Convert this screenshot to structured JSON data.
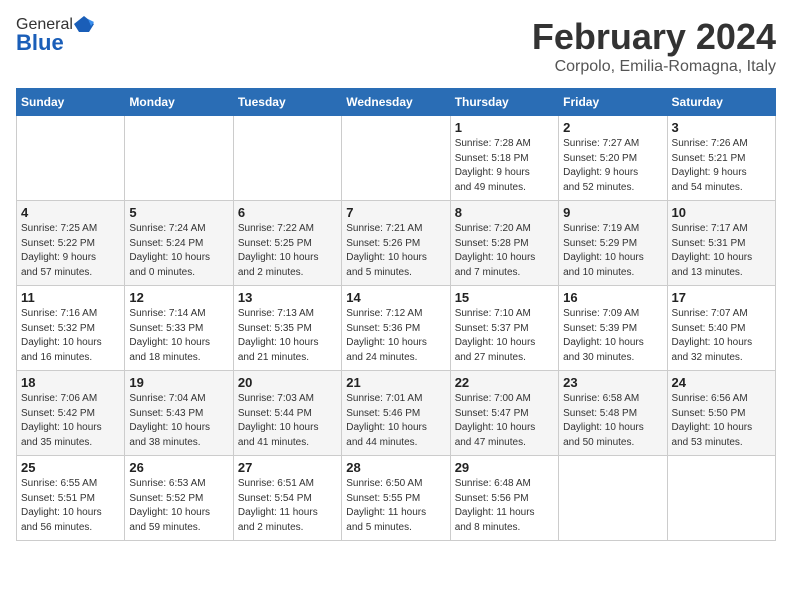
{
  "header": {
    "logo_general": "General",
    "logo_blue": "Blue",
    "month_title": "February 2024",
    "location": "Corpolo, Emilia-Romagna, Italy"
  },
  "days_of_week": [
    "Sunday",
    "Monday",
    "Tuesday",
    "Wednesday",
    "Thursday",
    "Friday",
    "Saturday"
  ],
  "weeks": [
    [
      {
        "day": "",
        "info": ""
      },
      {
        "day": "",
        "info": ""
      },
      {
        "day": "",
        "info": ""
      },
      {
        "day": "",
        "info": ""
      },
      {
        "day": "1",
        "info": "Sunrise: 7:28 AM\nSunset: 5:18 PM\nDaylight: 9 hours\nand 49 minutes."
      },
      {
        "day": "2",
        "info": "Sunrise: 7:27 AM\nSunset: 5:20 PM\nDaylight: 9 hours\nand 52 minutes."
      },
      {
        "day": "3",
        "info": "Sunrise: 7:26 AM\nSunset: 5:21 PM\nDaylight: 9 hours\nand 54 minutes."
      }
    ],
    [
      {
        "day": "4",
        "info": "Sunrise: 7:25 AM\nSunset: 5:22 PM\nDaylight: 9 hours\nand 57 minutes."
      },
      {
        "day": "5",
        "info": "Sunrise: 7:24 AM\nSunset: 5:24 PM\nDaylight: 10 hours\nand 0 minutes."
      },
      {
        "day": "6",
        "info": "Sunrise: 7:22 AM\nSunset: 5:25 PM\nDaylight: 10 hours\nand 2 minutes."
      },
      {
        "day": "7",
        "info": "Sunrise: 7:21 AM\nSunset: 5:26 PM\nDaylight: 10 hours\nand 5 minutes."
      },
      {
        "day": "8",
        "info": "Sunrise: 7:20 AM\nSunset: 5:28 PM\nDaylight: 10 hours\nand 7 minutes."
      },
      {
        "day": "9",
        "info": "Sunrise: 7:19 AM\nSunset: 5:29 PM\nDaylight: 10 hours\nand 10 minutes."
      },
      {
        "day": "10",
        "info": "Sunrise: 7:17 AM\nSunset: 5:31 PM\nDaylight: 10 hours\nand 13 minutes."
      }
    ],
    [
      {
        "day": "11",
        "info": "Sunrise: 7:16 AM\nSunset: 5:32 PM\nDaylight: 10 hours\nand 16 minutes."
      },
      {
        "day": "12",
        "info": "Sunrise: 7:14 AM\nSunset: 5:33 PM\nDaylight: 10 hours\nand 18 minutes."
      },
      {
        "day": "13",
        "info": "Sunrise: 7:13 AM\nSunset: 5:35 PM\nDaylight: 10 hours\nand 21 minutes."
      },
      {
        "day": "14",
        "info": "Sunrise: 7:12 AM\nSunset: 5:36 PM\nDaylight: 10 hours\nand 24 minutes."
      },
      {
        "day": "15",
        "info": "Sunrise: 7:10 AM\nSunset: 5:37 PM\nDaylight: 10 hours\nand 27 minutes."
      },
      {
        "day": "16",
        "info": "Sunrise: 7:09 AM\nSunset: 5:39 PM\nDaylight: 10 hours\nand 30 minutes."
      },
      {
        "day": "17",
        "info": "Sunrise: 7:07 AM\nSunset: 5:40 PM\nDaylight: 10 hours\nand 32 minutes."
      }
    ],
    [
      {
        "day": "18",
        "info": "Sunrise: 7:06 AM\nSunset: 5:42 PM\nDaylight: 10 hours\nand 35 minutes."
      },
      {
        "day": "19",
        "info": "Sunrise: 7:04 AM\nSunset: 5:43 PM\nDaylight: 10 hours\nand 38 minutes."
      },
      {
        "day": "20",
        "info": "Sunrise: 7:03 AM\nSunset: 5:44 PM\nDaylight: 10 hours\nand 41 minutes."
      },
      {
        "day": "21",
        "info": "Sunrise: 7:01 AM\nSunset: 5:46 PM\nDaylight: 10 hours\nand 44 minutes."
      },
      {
        "day": "22",
        "info": "Sunrise: 7:00 AM\nSunset: 5:47 PM\nDaylight: 10 hours\nand 47 minutes."
      },
      {
        "day": "23",
        "info": "Sunrise: 6:58 AM\nSunset: 5:48 PM\nDaylight: 10 hours\nand 50 minutes."
      },
      {
        "day": "24",
        "info": "Sunrise: 6:56 AM\nSunset: 5:50 PM\nDaylight: 10 hours\nand 53 minutes."
      }
    ],
    [
      {
        "day": "25",
        "info": "Sunrise: 6:55 AM\nSunset: 5:51 PM\nDaylight: 10 hours\nand 56 minutes."
      },
      {
        "day": "26",
        "info": "Sunrise: 6:53 AM\nSunset: 5:52 PM\nDaylight: 10 hours\nand 59 minutes."
      },
      {
        "day": "27",
        "info": "Sunrise: 6:51 AM\nSunset: 5:54 PM\nDaylight: 11 hours\nand 2 minutes."
      },
      {
        "day": "28",
        "info": "Sunrise: 6:50 AM\nSunset: 5:55 PM\nDaylight: 11 hours\nand 5 minutes."
      },
      {
        "day": "29",
        "info": "Sunrise: 6:48 AM\nSunset: 5:56 PM\nDaylight: 11 hours\nand 8 minutes."
      },
      {
        "day": "",
        "info": ""
      },
      {
        "day": "",
        "info": ""
      }
    ]
  ]
}
